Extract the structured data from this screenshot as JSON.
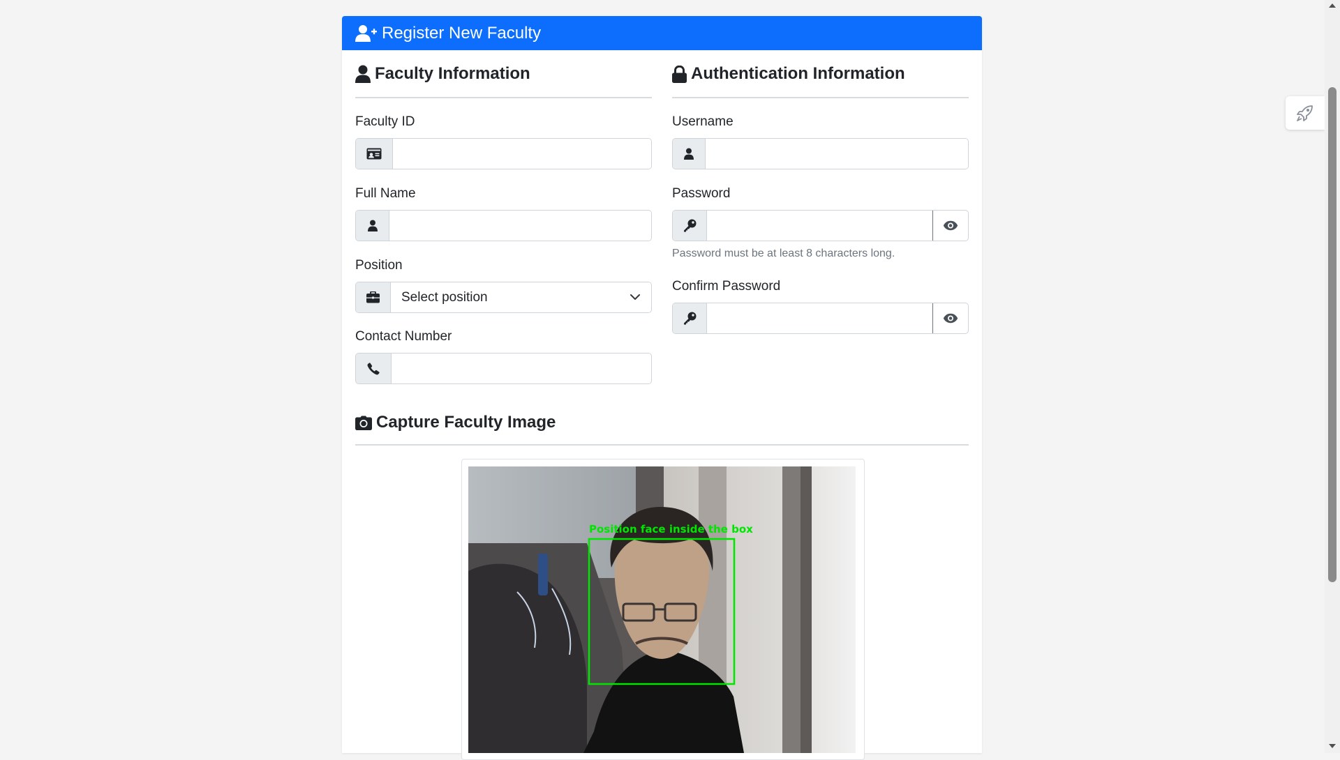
{
  "form": {
    "header_title": "Register New Faculty",
    "header_color": "#0d6efd"
  },
  "faculty_section": {
    "title": "Faculty Information",
    "faculty_id": {
      "label": "Faculty ID",
      "value": ""
    },
    "full_name": {
      "label": "Full Name",
      "value": ""
    },
    "position": {
      "label": "Position",
      "selected": "Select position"
    },
    "contact": {
      "label": "Contact Number",
      "value": ""
    }
  },
  "auth_section": {
    "title": "Authentication Information",
    "username": {
      "label": "Username",
      "value": ""
    },
    "password": {
      "label": "Password",
      "value": "",
      "help": "Password must be at least 8 characters long."
    },
    "confirm_password": {
      "label": "Confirm Password",
      "value": ""
    }
  },
  "capture_section": {
    "title": "Capture Faculty Image",
    "overlay_text": "Position face inside the box",
    "overlay_color": "#00e600"
  },
  "icons": {
    "header": "user-plus-icon",
    "faculty": "user-icon",
    "auth": "lock-icon",
    "camera": "camera-icon",
    "id_card": "id-card-icon",
    "key": "key-icon",
    "eye": "eye-icon",
    "briefcase": "briefcase-icon",
    "phone": "phone-icon",
    "rocket": "rocket-icon"
  }
}
